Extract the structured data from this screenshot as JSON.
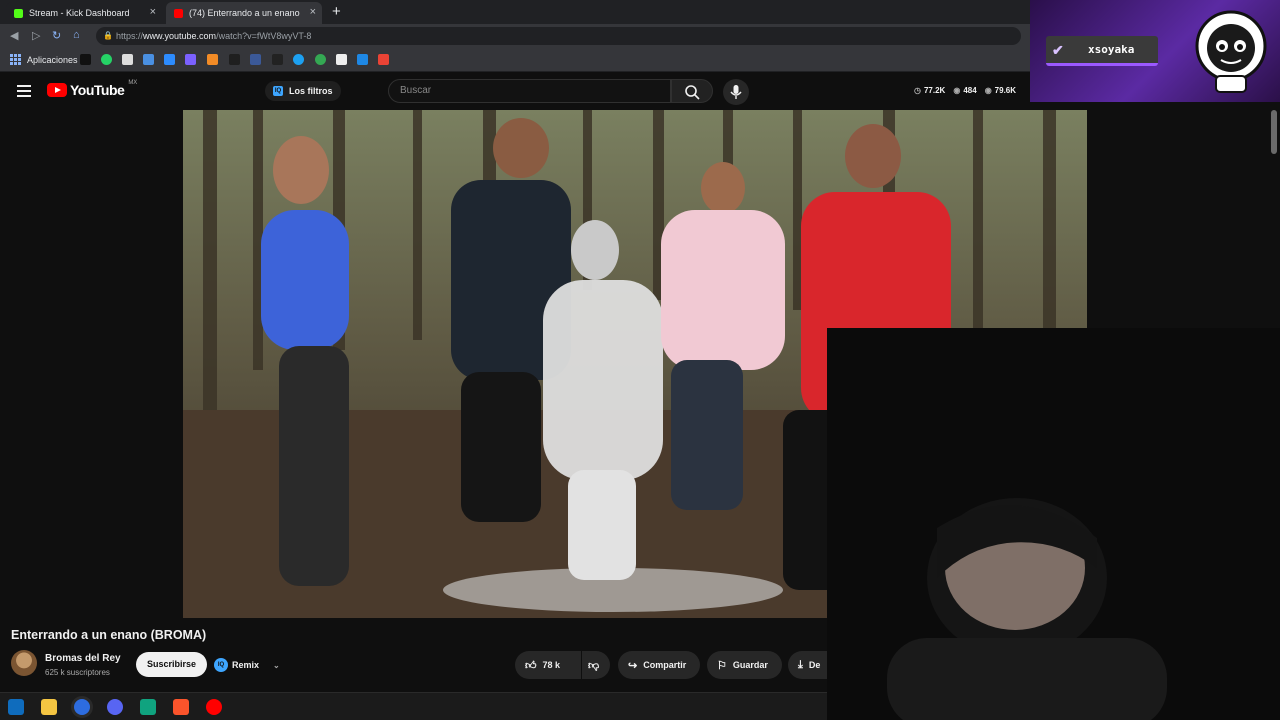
{
  "browser": {
    "tabs": [
      {
        "label": "Stream - Kick Dashboard",
        "color": "#53fc18"
      },
      {
        "label": "(74) Enterrando a un enano",
        "color": "#ff0000"
      }
    ],
    "new_tab": "+",
    "url_prefix": "https://",
    "url_host": "www.youtube.com",
    "url_path": "/watch?v=fWtV8wyVT-8",
    "bookmarks_label": "Aplicaciones"
  },
  "overlay": {
    "username": "xsoyaka"
  },
  "youtube": {
    "logo_text": "YouTube",
    "country": "MX",
    "filters_label": "Los filtros",
    "filters_icon": "IQ",
    "search_placeholder": "Buscar",
    "stats": {
      "likes": "77.2K",
      "viewers": "484",
      "views": "79.6K"
    }
  },
  "video": {
    "title": "Enterrando a un enano (BROMA)",
    "channel": "Bromas del Rey",
    "subscribers": "625 k suscriptores",
    "subscribe_label": "Suscribirse",
    "remix_label": "Remix",
    "remix_icon": "IQ",
    "like_count": "78 k",
    "share_label": "Compartir",
    "save_label": "Guardar",
    "download_label": "De"
  }
}
